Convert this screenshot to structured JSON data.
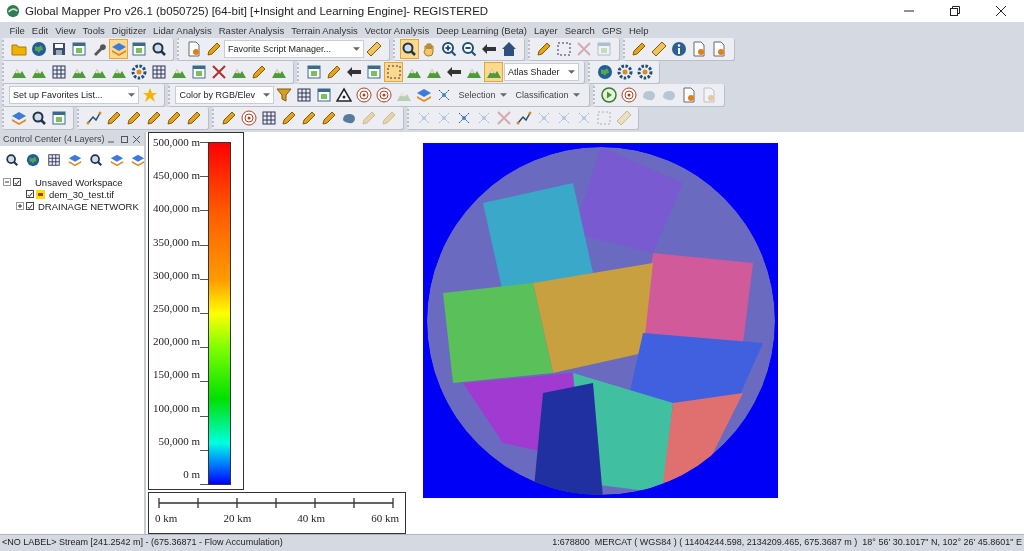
{
  "window": {
    "title": "Global Mapper Pro v26.1 (b050725) [64-bit] [+Insight and Learning Engine]- REGISTERED"
  },
  "menu": [
    "File",
    "Edit",
    "View",
    "Tools",
    "Digitizer",
    "Lidar Analysis",
    "Raster Analysis",
    "Terrain Analysis",
    "Vector Analysis",
    "Deep Learning (Beta)",
    "Layer",
    "Search",
    "GPS",
    "Help"
  ],
  "toolbar_rows": [
    [
      {
        "items": [
          {
            "kind": "icon",
            "selected": false,
            "disabled": false
          },
          {
            "kind": "icon",
            "selected": false,
            "disabled": false
          },
          {
            "kind": "icon",
            "selected": false,
            "disabled": false
          },
          {
            "kind": "icon",
            "selected": false,
            "disabled": false
          },
          {
            "kind": "icon",
            "selected": false,
            "disabled": false
          },
          {
            "kind": "icon",
            "selected": true,
            "disabled": false
          },
          {
            "kind": "icon",
            "selected": false,
            "disabled": false
          },
          {
            "kind": "icon",
            "selected": false,
            "disabled": false
          }
        ]
      },
      {
        "items": [
          {
            "kind": "icon",
            "selected": false,
            "disabled": false
          },
          {
            "kind": "icon",
            "selected": false,
            "disabled": false
          },
          {
            "kind": "dropdown",
            "value": "Favorite Script Manager..."
          },
          {
            "kind": "icon",
            "selected": false,
            "disabled": false
          }
        ]
      },
      {
        "items": [
          {
            "kind": "icon",
            "selected": true,
            "disabled": false
          },
          {
            "kind": "icon",
            "selected": false,
            "disabled": false
          },
          {
            "kind": "icon",
            "selected": false,
            "disabled": false
          },
          {
            "kind": "icon",
            "selected": false,
            "disabled": false
          },
          {
            "kind": "icon",
            "selected": false,
            "disabled": false
          },
          {
            "kind": "icon",
            "selected": false,
            "disabled": false
          }
        ]
      },
      {
        "items": [
          {
            "kind": "icon",
            "selected": false,
            "disabled": false
          },
          {
            "kind": "icon",
            "selected": false,
            "disabled": false
          },
          {
            "kind": "icon",
            "selected": false,
            "disabled": true
          },
          {
            "kind": "icon",
            "selected": false,
            "disabled": true
          }
        ]
      },
      {
        "items": [
          {
            "kind": "icon",
            "selected": false,
            "disabled": false
          },
          {
            "kind": "icon",
            "selected": false,
            "disabled": false
          },
          {
            "kind": "icon",
            "selected": false,
            "disabled": false
          },
          {
            "kind": "icon",
            "selected": false,
            "disabled": false
          },
          {
            "kind": "icon",
            "selected": false,
            "disabled": false
          }
        ]
      }
    ],
    [
      {
        "items": [
          {
            "kind": "icon",
            "selected": false,
            "disabled": false
          },
          {
            "kind": "icon",
            "selected": false,
            "disabled": false
          },
          {
            "kind": "icon",
            "selected": false,
            "disabled": false
          },
          {
            "kind": "icon",
            "selected": false,
            "disabled": false
          },
          {
            "kind": "icon",
            "selected": false,
            "disabled": false
          },
          {
            "kind": "icon",
            "selected": false,
            "disabled": false
          },
          {
            "kind": "icon",
            "selected": false,
            "disabled": false
          },
          {
            "kind": "icon",
            "selected": false,
            "disabled": false
          },
          {
            "kind": "icon",
            "selected": false,
            "disabled": false
          },
          {
            "kind": "icon",
            "selected": false,
            "disabled": false
          },
          {
            "kind": "icon",
            "selected": false,
            "disabled": false
          },
          {
            "kind": "icon",
            "selected": false,
            "disabled": false
          },
          {
            "kind": "icon",
            "selected": false,
            "disabled": false
          },
          {
            "kind": "icon",
            "selected": false,
            "disabled": false
          }
        ]
      },
      {
        "items": [
          {
            "kind": "icon",
            "selected": false,
            "disabled": false
          },
          {
            "kind": "icon",
            "selected": false,
            "disabled": false
          },
          {
            "kind": "icon",
            "selected": false,
            "disabled": false
          },
          {
            "kind": "icon",
            "selected": false,
            "disabled": false
          },
          {
            "kind": "icon",
            "selected": true,
            "disabled": false
          },
          {
            "kind": "icon",
            "selected": false,
            "disabled": false
          },
          {
            "kind": "icon",
            "selected": false,
            "disabled": false
          },
          {
            "kind": "icon",
            "selected": false,
            "disabled": false
          },
          {
            "kind": "icon",
            "selected": false,
            "disabled": false
          },
          {
            "kind": "icon",
            "selected": true,
            "disabled": false
          },
          {
            "kind": "dropdown",
            "value": "Atlas Shader"
          }
        ]
      },
      {
        "items": [
          {
            "kind": "icon",
            "selected": false,
            "disabled": false
          },
          {
            "kind": "icon",
            "selected": false,
            "disabled": false
          },
          {
            "kind": "icon",
            "selected": false,
            "disabled": false
          }
        ]
      }
    ],
    [
      {
        "items": [
          {
            "kind": "dropdown",
            "value": "Set up Favorites List..."
          },
          {
            "kind": "icon",
            "selected": false,
            "disabled": false
          }
        ]
      },
      {
        "items": [
          {
            "kind": "dropdown",
            "value": "Color by RGB/Elev"
          },
          {
            "kind": "icon",
            "selected": false,
            "disabled": false
          },
          {
            "kind": "icon",
            "selected": false,
            "disabled": false
          },
          {
            "kind": "icon",
            "selected": false,
            "disabled": false
          },
          {
            "kind": "icon",
            "selected": false,
            "disabled": false
          },
          {
            "kind": "icon",
            "selected": false,
            "disabled": false
          },
          {
            "kind": "icon",
            "selected": false,
            "disabled": false
          },
          {
            "kind": "icon",
            "selected": false,
            "disabled": true
          },
          {
            "kind": "icon",
            "selected": false,
            "disabled": false
          },
          {
            "kind": "icon",
            "selected": false,
            "disabled": false
          },
          {
            "kind": "menu",
            "label": "Selection"
          },
          {
            "kind": "menu",
            "label": "Classification"
          }
        ]
      },
      {
        "items": [
          {
            "kind": "icon",
            "selected": false,
            "disabled": false
          },
          {
            "kind": "icon",
            "selected": false,
            "disabled": false
          },
          {
            "kind": "icon",
            "selected": false,
            "disabled": true
          },
          {
            "kind": "icon",
            "selected": false,
            "disabled": true
          },
          {
            "kind": "icon",
            "selected": false,
            "disabled": false
          },
          {
            "kind": "icon",
            "selected": false,
            "disabled": true
          }
        ]
      }
    ],
    [
      {
        "items": [
          {
            "kind": "icon",
            "selected": false,
            "disabled": false
          },
          {
            "kind": "icon",
            "selected": false,
            "disabled": false
          },
          {
            "kind": "icon",
            "selected": false,
            "disabled": false
          }
        ]
      },
      {
        "items": [
          {
            "kind": "icon",
            "selected": false,
            "disabled": false
          },
          {
            "kind": "icon",
            "selected": false,
            "disabled": false
          },
          {
            "kind": "icon",
            "selected": false,
            "disabled": false
          },
          {
            "kind": "icon",
            "selected": false,
            "disabled": false
          },
          {
            "kind": "icon",
            "selected": false,
            "disabled": false
          },
          {
            "kind": "icon",
            "selected": false,
            "disabled": false
          }
        ]
      },
      {
        "items": [
          {
            "kind": "icon",
            "selected": false,
            "disabled": false
          },
          {
            "kind": "icon",
            "selected": false,
            "disabled": false
          },
          {
            "kind": "icon",
            "selected": false,
            "disabled": false
          },
          {
            "kind": "icon",
            "selected": false,
            "disabled": false
          },
          {
            "kind": "icon",
            "selected": false,
            "disabled": false
          },
          {
            "kind": "icon",
            "selected": false,
            "disabled": false
          },
          {
            "kind": "icon",
            "selected": false,
            "disabled": false
          },
          {
            "kind": "icon",
            "selected": false,
            "disabled": true
          },
          {
            "kind": "icon",
            "selected": false,
            "disabled": true
          }
        ]
      },
      {
        "items": [
          {
            "kind": "icon",
            "selected": false,
            "disabled": true
          },
          {
            "kind": "icon",
            "selected": false,
            "disabled": true
          },
          {
            "kind": "icon",
            "selected": false,
            "disabled": false
          },
          {
            "kind": "icon",
            "selected": false,
            "disabled": true
          },
          {
            "kind": "icon",
            "selected": false,
            "disabled": true
          },
          {
            "kind": "icon",
            "selected": false,
            "disabled": false
          },
          {
            "kind": "icon",
            "selected": false,
            "disabled": true
          },
          {
            "kind": "icon",
            "selected": false,
            "disabled": true
          },
          {
            "kind": "icon",
            "selected": false,
            "disabled": true
          },
          {
            "kind": "icon",
            "selected": false,
            "disabled": true
          },
          {
            "kind": "icon",
            "selected": false,
            "disabled": true
          }
        ]
      }
    ]
  ],
  "control_center": {
    "title": "Control Center (4 Layers)",
    "tree": [
      {
        "label": "Unsaved Workspace",
        "kind": "workspace",
        "checked": true,
        "expanded": true,
        "children": [
          {
            "label": "dem_30_test.tif",
            "kind": "raster",
            "checked": true
          },
          {
            "label": "DRAINAGE NETWORK",
            "kind": "vector",
            "checked": true,
            "expanded": false
          }
        ]
      }
    ]
  },
  "legend": {
    "labels": [
      "500,000 m",
      "450,000 m",
      "400,000 m",
      "350,000 m",
      "300,000 m",
      "250,000 m",
      "200,000 m",
      "150,000 m",
      "100,000 m",
      "50,000 m",
      "0 m"
    ]
  },
  "scale_bar": {
    "labels": [
      "0 km",
      "20 km",
      "40 km",
      "60 km"
    ]
  },
  "map": {
    "kind": "picture"
  },
  "status_bar": {
    "feature": "<NO LABEL> Stream [241.2542 m] - (675.36871 - Flow Accumulation)",
    "scale": "1:678800",
    "projection": "MERCAT ( WGS84 ) ( 11404244.598, 2134209.465, 675.3687 m )",
    "latlon": "18° 56' 30.1017\" N, 102° 26' 45.8601\" E"
  }
}
